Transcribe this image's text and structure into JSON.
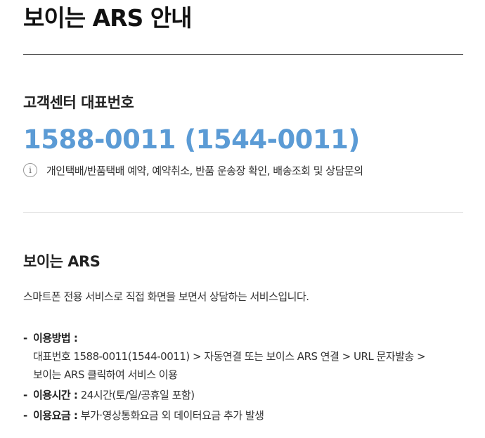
{
  "page": {
    "title": "보이는 ARS 안내"
  },
  "customer_center": {
    "heading": "고객센터 대표번호",
    "phone": "1588-0011 (1544-0011)",
    "info_icon": "info-icon",
    "info_text": "개인택배/반품택배 예약, 예약취소, 반품 운송장 확인, 배송조회 및 상담문의"
  },
  "ars": {
    "heading": "보이는 ARS",
    "description": "스마트폰 전용 서비스로 직접 화면을 보면서 상담하는 서비스입니다.",
    "items": [
      {
        "dash": "-",
        "label": "이용방법 :",
        "value": "",
        "lines": [
          "대표번호 1588-0011(1544-0011) > 자동연결 또는 보이스 ARS 연결 > URL 문자발송 >",
          "보이는 ARS 클릭하여 서비스 이용"
        ]
      },
      {
        "dash": "-",
        "label": "이용시간 :",
        "value": " 24시간(토/일/공휴일 포함)"
      },
      {
        "dash": "-",
        "label": "이용요금 :",
        "value": " 부가·영상통화요금 외 데이터요금 추가 발생"
      }
    ]
  },
  "colors": {
    "phone_accent": "#5b9bd5"
  }
}
